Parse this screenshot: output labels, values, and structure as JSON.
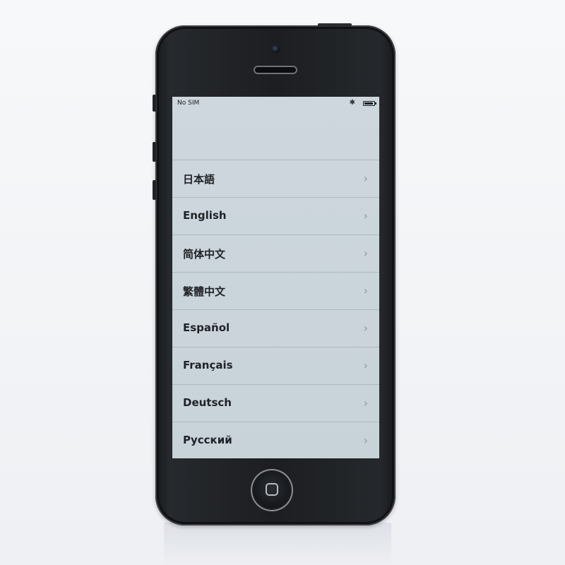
{
  "status_bar": {
    "carrier": "No SIM",
    "bluetooth_icon": "bluetooth-icon",
    "battery_icon": "battery-icon"
  },
  "languages": [
    "日本語",
    "English",
    "简体中文",
    "繁體中文",
    "Español",
    "Français",
    "Deutsch",
    "Русский"
  ],
  "icons": {
    "chevron": "chevron-right-icon",
    "home": "home-button-icon"
  },
  "colors": {
    "screen_background": "#cdd7dd",
    "phone_body": "#1c1e21",
    "text": "#202328",
    "chevron": "#8f979d"
  }
}
